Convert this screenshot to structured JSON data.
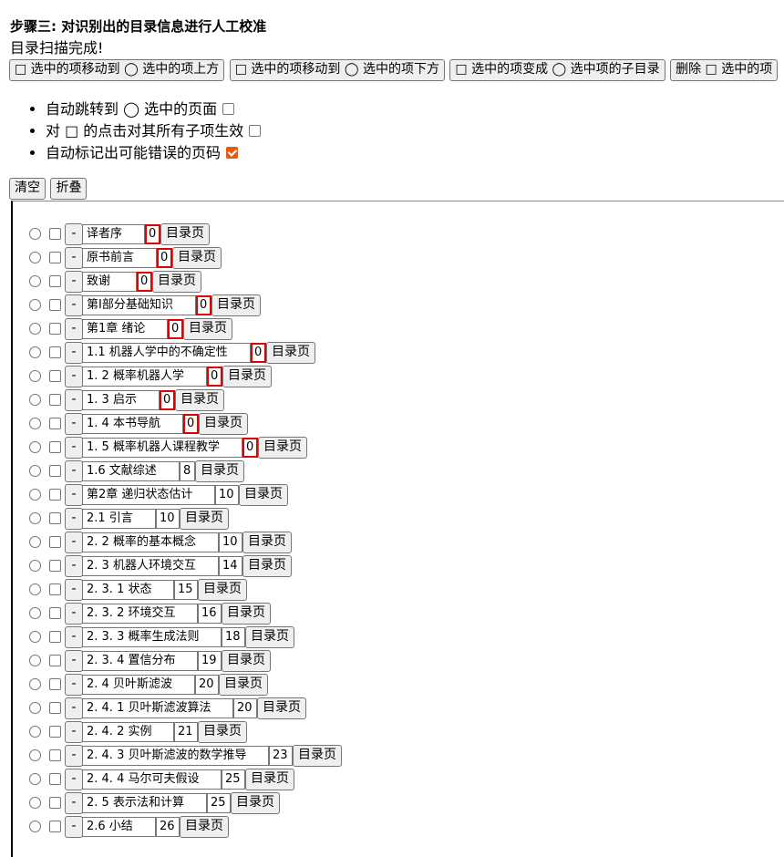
{
  "header": {
    "step_title": "步骤三: 对识别出的目录信息进行人工校准",
    "status": "目录扫描完成!"
  },
  "actions": [
    {
      "name": "move-up-button",
      "label": "□ 选中的项移动到 ◯ 选中的项上方"
    },
    {
      "name": "move-down-button",
      "label": "□ 选中的项移动到 ◯ 选中的项下方"
    },
    {
      "name": "make-child-button",
      "label": "□ 选中的项变成 ◯ 选中项的子目录"
    },
    {
      "name": "delete-button",
      "label": "删除 □ 选中的项"
    }
  ],
  "options": [
    {
      "name": "auto-jump",
      "label": "自动跳转到 ◯ 选中的页面",
      "checked": false
    },
    {
      "name": "apply-children",
      "label": "对 □ 的点击对其所有子项生效",
      "checked": false
    },
    {
      "name": "mark-errors",
      "label": "自动标记出可能错误的页码",
      "checked": true
    }
  ],
  "tree_tools": {
    "clear_label": "清空",
    "collapse_label": "折叠"
  },
  "row_controls": {
    "minus_label": "-",
    "toc_label": "目录页"
  },
  "colors": {
    "checkbox_accent": "#e8590c",
    "error_border": "#e00000"
  },
  "entries": [
    {
      "title": "译者序",
      "page": "0",
      "error": true
    },
    {
      "title": "原书前言",
      "page": "0",
      "error": true
    },
    {
      "title": "致谢",
      "page": "0",
      "error": true
    },
    {
      "title": "第I部分基础知识",
      "page": "0",
      "error": true
    },
    {
      "title": "第1章 绪论",
      "page": "0",
      "error": true
    },
    {
      "title": "1.1 机器人学中的不确定性",
      "page": "0",
      "error": true
    },
    {
      "title": "1. 2 概率机器人学",
      "page": "0",
      "error": true
    },
    {
      "title": "1. 3 启示",
      "page": "0",
      "error": true
    },
    {
      "title": "1. 4 本书导航",
      "page": "0",
      "error": true
    },
    {
      "title": "1. 5 概率机器人课程教学",
      "page": "0",
      "error": true
    },
    {
      "title": "1.6 文献综述",
      "page": "8",
      "error": false
    },
    {
      "title": "第2章 递归状态估计",
      "page": "10",
      "error": false
    },
    {
      "title": "2.1 引言",
      "page": "10",
      "error": false
    },
    {
      "title": "2. 2 概率的基本概念",
      "page": "10",
      "error": false
    },
    {
      "title": "2. 3 机器人环境交互",
      "page": "14",
      "error": false
    },
    {
      "title": "2. 3. 1 状态",
      "page": "15",
      "error": false
    },
    {
      "title": "2. 3. 2 环境交互",
      "page": "16",
      "error": false
    },
    {
      "title": "2. 3. 3 概率生成法则",
      "page": "18",
      "error": false
    },
    {
      "title": "2. 3. 4 置信分布",
      "page": "19",
      "error": false
    },
    {
      "title": "2. 4 贝叶斯滤波",
      "page": "20",
      "error": false
    },
    {
      "title": "2. 4. 1 贝叶斯滤波算法",
      "page": "20",
      "error": false
    },
    {
      "title": "2. 4. 2 实例",
      "page": "21",
      "error": false
    },
    {
      "title": "2. 4. 3 贝叶斯滤波的数学推导",
      "page": "23",
      "error": false
    },
    {
      "title": "2. 4. 4 马尔可夫假设",
      "page": "25",
      "error": false
    },
    {
      "title": "2. 5 表示法和计算",
      "page": "25",
      "error": false
    },
    {
      "title": "2.6 小结",
      "page": "26",
      "error": false
    }
  ]
}
